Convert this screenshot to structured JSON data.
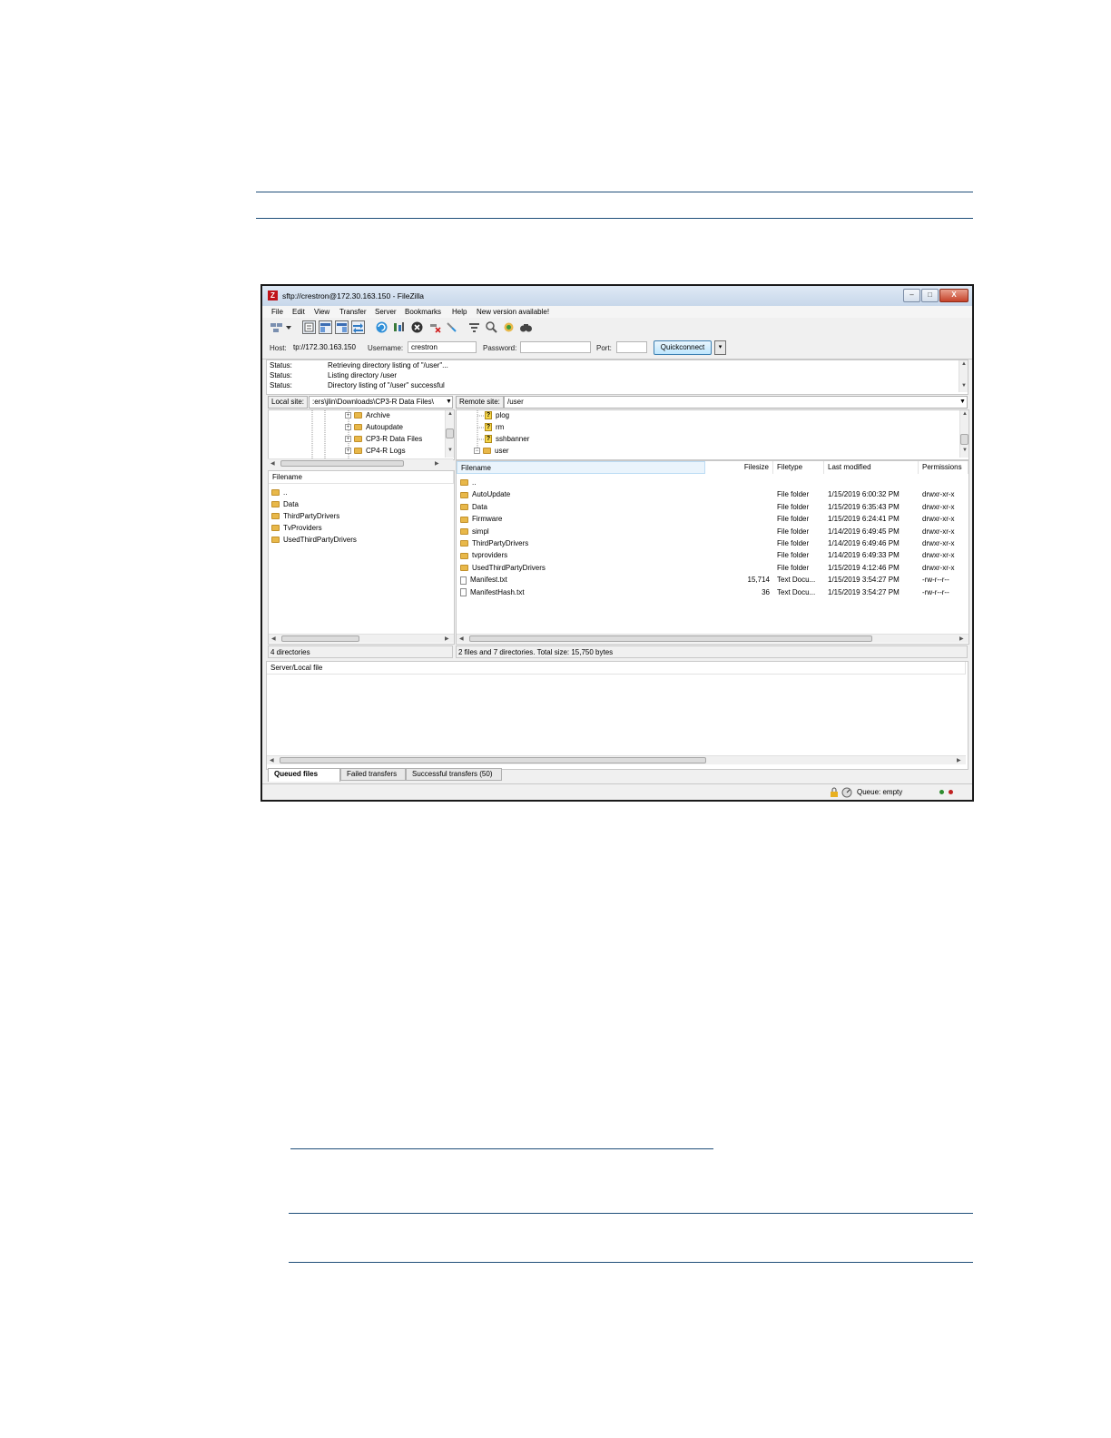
{
  "window": {
    "title": "sftp://crestron@172.30.163.150 - FileZilla",
    "logo_letter": "Z",
    "controls": {
      "minimize": "–",
      "maximize": "□",
      "close": "X"
    }
  },
  "menu": [
    "File",
    "Edit",
    "View",
    "Transfer",
    "Server",
    "Bookmarks",
    "Help",
    "New version available!"
  ],
  "quickconnect": {
    "host_label": "Host:",
    "host_value": "tp://172.30.163.150",
    "username_label": "Username:",
    "username_value": "crestron",
    "password_label": "Password:",
    "password_value": "",
    "port_label": "Port:",
    "port_value": "",
    "button_label": "Quickconnect",
    "dropdown": "▾"
  },
  "log": [
    {
      "key": "Status:",
      "text": "Retrieving directory listing of \"/user\"..."
    },
    {
      "key": "Status:",
      "text": "Listing directory /user"
    },
    {
      "key": "Status:",
      "text": "Directory listing of \"/user\" successful"
    }
  ],
  "local": {
    "site_label": "Local site:",
    "path": ":ers\\jlin\\Downloads\\CP3-R Data Files\\",
    "tree": [
      {
        "label": "Archive"
      },
      {
        "label": "Autoupdate"
      },
      {
        "label": "CP3-R Data Files"
      },
      {
        "label": "CP4-R Logs"
      }
    ],
    "header": "Filename",
    "files": [
      "..",
      "Data",
      "ThirdPartyDrivers",
      "TvProviders",
      "UsedThirdPartyDrivers"
    ],
    "status": "4 directories"
  },
  "remote": {
    "site_label": "Remote site:",
    "path": "/user",
    "tree": [
      {
        "label": "plog",
        "icon": "?"
      },
      {
        "label": "rm",
        "icon": "?"
      },
      {
        "label": "sshbanner",
        "icon": "?"
      },
      {
        "label": "user",
        "icon": ""
      }
    ],
    "headers": {
      "filename": "Filename",
      "filesize": "Filesize",
      "filetype": "Filetype",
      "modified": "Last modified",
      "permissions": "Permissions"
    },
    "files": [
      {
        "name": "..",
        "size": "",
        "type": "",
        "modified": "",
        "perms": "",
        "kind": "folder"
      },
      {
        "name": "AutoUpdate",
        "size": "",
        "type": "File folder",
        "modified": "1/15/2019 6:00:32 PM",
        "perms": "drwxr-xr-x",
        "kind": "folder"
      },
      {
        "name": "Data",
        "size": "",
        "type": "File folder",
        "modified": "1/15/2019 6:35:43 PM",
        "perms": "drwxr-xr-x",
        "kind": "folder"
      },
      {
        "name": "Firmware",
        "size": "",
        "type": "File folder",
        "modified": "1/15/2019 6:24:41 PM",
        "perms": "drwxr-xr-x",
        "kind": "folder"
      },
      {
        "name": "simpl",
        "size": "",
        "type": "File folder",
        "modified": "1/14/2019 6:49:45 PM",
        "perms": "drwxr-xr-x",
        "kind": "folder"
      },
      {
        "name": "ThirdPartyDrivers",
        "size": "",
        "type": "File folder",
        "modified": "1/14/2019 6:49:46 PM",
        "perms": "drwxr-xr-x",
        "kind": "folder"
      },
      {
        "name": "tvproviders",
        "size": "",
        "type": "File folder",
        "modified": "1/14/2019 6:49:33 PM",
        "perms": "drwxr-xr-x",
        "kind": "folder"
      },
      {
        "name": "UsedThirdPartyDrivers",
        "size": "",
        "type": "File folder",
        "modified": "1/15/2019 4:12:46 PM",
        "perms": "drwxr-xr-x",
        "kind": "folder"
      },
      {
        "name": "Manifest.txt",
        "size": "15,714",
        "type": "Text Docu...",
        "modified": "1/15/2019 3:54:27 PM",
        "perms": "-rw-r--r--",
        "kind": "file"
      },
      {
        "name": "ManifestHash.txt",
        "size": "36",
        "type": "Text Docu...",
        "modified": "1/15/2019 3:54:27 PM",
        "perms": "-rw-r--r--",
        "kind": "file"
      }
    ],
    "status": "2 files and 7 directories. Total size: 15,750 bytes"
  },
  "queue": {
    "header": "Server/Local file",
    "tabs": [
      "Queued files",
      "Failed transfers",
      "Successful transfers (50)"
    ]
  },
  "statusbar": {
    "queue_text": "Queue: empty"
  },
  "colors": {
    "rule": "#1f4e79",
    "folder": "#e8b84a",
    "titlebar": "#c7d7ea",
    "led_green": "#2e8b2e",
    "led_red": "#c02020"
  }
}
